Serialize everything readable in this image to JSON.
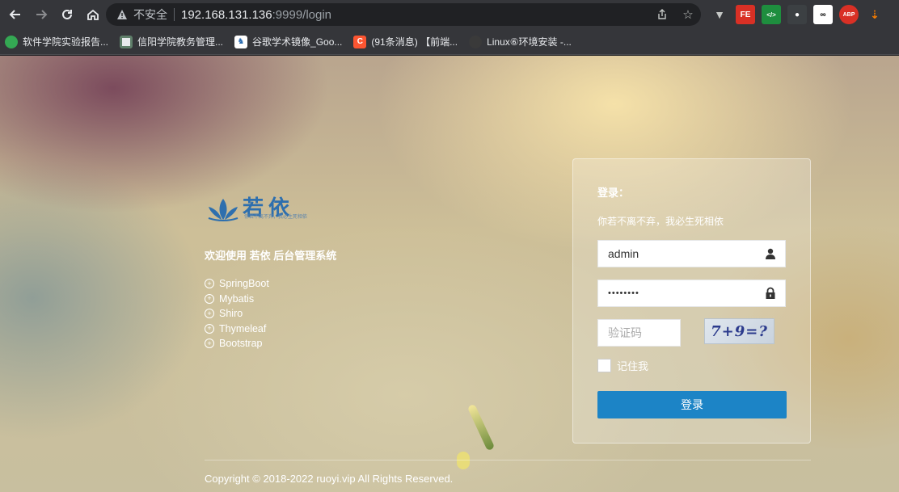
{
  "browser": {
    "insecure_label": "不安全",
    "url_host": "192.168.131.136",
    "url_rest": ":9999/login",
    "extensions": [
      "FE",
      "</>",
      "ABP"
    ]
  },
  "bookmarks": [
    {
      "label": "软件学院实验报告...",
      "icon_color": "#34a853"
    },
    {
      "label": "信阳学院教务管理...",
      "icon_color": "#5f7f6a"
    },
    {
      "label": "谷歌学术镜像_Goo...",
      "icon_color": "#2b6cb0"
    },
    {
      "label": "(91条消息) 【前端...",
      "icon_color": "#fc5531",
      "icon_text": "C"
    },
    {
      "label": "Linux⑥环境安装 -...",
      "icon_color": "#3a3a3a"
    }
  ],
  "brand": {
    "logo_text": "若依",
    "logo_tagline": "你若不离不弃，我必生死相依",
    "color": "#2e6fae"
  },
  "welcome": "欢迎使用 若依 后台管理系统",
  "tech_stack": [
    "SpringBoot",
    "Mybatis",
    "Shiro",
    "Thymeleaf",
    "Bootstrap"
  ],
  "login": {
    "title": "登录：",
    "subtitle": "你若不离不弃，我必生死相依",
    "username_value": "admin",
    "password_value": "••••••••",
    "captcha_placeholder": "验证码",
    "captcha_text": "7+9=?",
    "remember_label": "记住我",
    "submit_label": "登录",
    "button_color": "#1c84c6"
  },
  "footer": {
    "copyright": "Copyright © 2018-2022 ruoyi.vip All Rights Reserved."
  }
}
